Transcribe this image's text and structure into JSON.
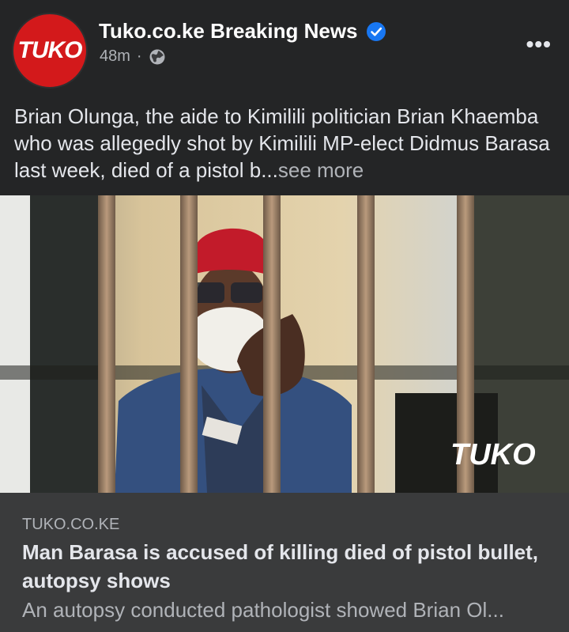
{
  "header": {
    "avatar_text": "TUKO",
    "page_name": "Tuko.co.ke Breaking News",
    "time": "48m",
    "separator": "·",
    "more_label": "•••"
  },
  "post": {
    "text": "Brian Olunga, the aide to Kimilili politician Brian Khaemba who was allegedly shot by Kimilili MP-elect Didmus Barasa last week, died of a pistol b",
    "ellipsis": "...",
    "see_more": "see more"
  },
  "photo": {
    "watermark": "TUKO"
  },
  "link": {
    "source": "TUKO.CO.KE",
    "headline": "Man Barasa is accused of killing died of pistol bullet, autopsy shows",
    "description": "An autopsy conducted pathologist showed Brian Ol..."
  },
  "colors": {
    "background": "#242526",
    "card": "#3a3b3c",
    "brand_red": "#d3191b",
    "verified_blue": "#1877f2"
  },
  "icons": [
    "verified-badge-icon",
    "globe-icon",
    "more-options-icon"
  ]
}
